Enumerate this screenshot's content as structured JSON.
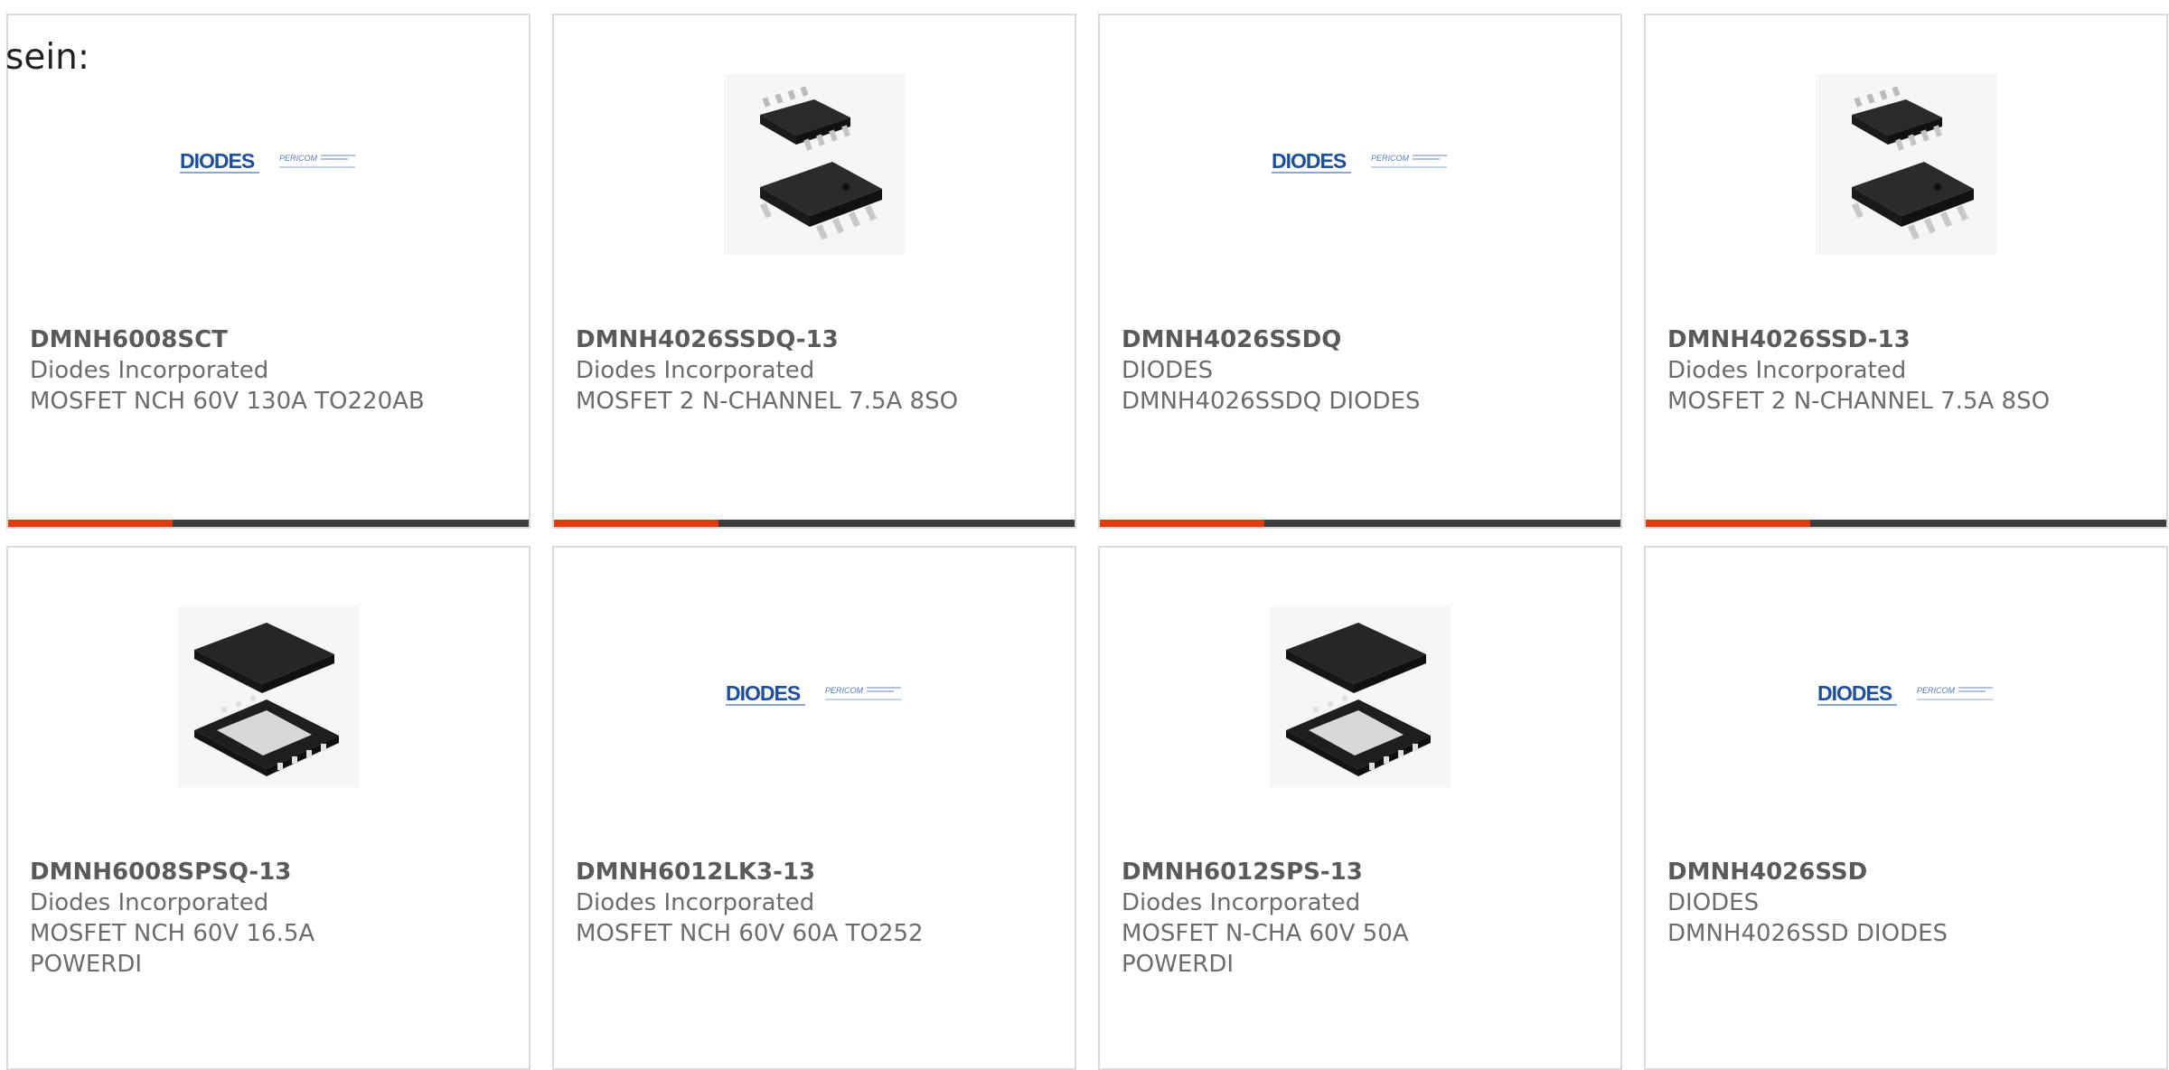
{
  "intro_text": "sein:",
  "colors": {
    "accent": "#e13a0c",
    "bar": "#3d3d3d",
    "border": "#dadada",
    "text": "#6c6c6c",
    "logo_blue": "#1d4f9e"
  },
  "logo": {
    "brand": "DIODES",
    "sub": "PERICOM"
  },
  "products": [
    {
      "part_number": "DMNH6008SCT",
      "manufacturer": "Diodes Incorporated",
      "description": "MOSFET NCH 60V 130A TO220AB",
      "image": "diodes-logo-icon"
    },
    {
      "part_number": "DMNH4026SSDQ-13",
      "manufacturer": "Diodes Incorporated",
      "description": "MOSFET 2 N-CHANNEL 7.5A 8SO",
      "image": "soic8-chip-icon"
    },
    {
      "part_number": "DMNH4026SSDQ",
      "manufacturer": "DIODES",
      "description": "DMNH4026SSDQ DIODES",
      "image": "diodes-logo-icon"
    },
    {
      "part_number": "DMNH4026SSD-13",
      "manufacturer": "Diodes Incorporated",
      "description": "MOSFET 2 N-CHANNEL 7.5A 8SO",
      "image": "soic8-chip-icon"
    },
    {
      "part_number": "DMNH6008SPSQ-13",
      "manufacturer": "Diodes Incorporated",
      "description": "MOSFET NCH 60V 16.5A POWERDI",
      "image": "powerdi-chip-icon"
    },
    {
      "part_number": "DMNH6012LK3-13",
      "manufacturer": "Diodes Incorporated",
      "description": "MOSFET NCH 60V 60A TO252",
      "image": "diodes-logo-icon"
    },
    {
      "part_number": "DMNH6012SPS-13",
      "manufacturer": "Diodes Incorporated",
      "description": "MOSFET N-CHA 60V 50A POWERDI",
      "image": "powerdi-chip-icon"
    },
    {
      "part_number": "DMNH4026SSD",
      "manufacturer": "DIODES",
      "description": "DMNH4026SSD DIODES",
      "image": "diodes-logo-icon"
    }
  ]
}
